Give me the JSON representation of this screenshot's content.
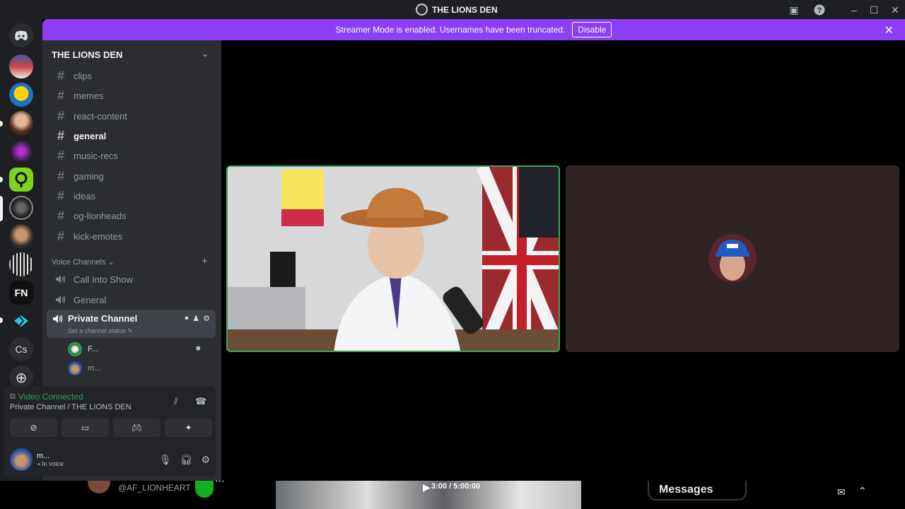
{
  "window": {
    "title": "THE LIONS DEN"
  },
  "banner": {
    "text": "Streamer Mode is enabled. Usernames have been truncated.",
    "button": "Disable"
  },
  "server": {
    "name": "THE LIONS DEN"
  },
  "rail": {
    "last_label": "Cs"
  },
  "channels": [
    {
      "label": "clips"
    },
    {
      "label": "memes"
    },
    {
      "label": "react-content"
    },
    {
      "label": "general"
    },
    {
      "label": "music-recs"
    },
    {
      "label": "gaming"
    },
    {
      "label": "ideas"
    },
    {
      "label": "og-lionheads"
    },
    {
      "label": "kick-emotes"
    }
  ],
  "voice": {
    "category": "Voice Channels",
    "channels": [
      {
        "label": "Call Into Show"
      },
      {
        "label": "General"
      }
    ],
    "private": {
      "label": "Private Channel",
      "status": "Set a channel status"
    },
    "users": [
      {
        "label": "F..."
      },
      {
        "label": "m..."
      }
    ]
  },
  "connection": {
    "status": "Video Connected",
    "location": "Private Channel / THE LIONS DEN"
  },
  "me": {
    "name": "m...",
    "status": "In voice"
  },
  "overlay": {
    "handle": "@AF_LIONHEART",
    "timecode": "3:00 / 5:00:00",
    "messages": "Messages"
  },
  "colors": {
    "banner": "#8c3ff5",
    "accent_green": "#23a55a",
    "speaking_border": "#3ba55c"
  }
}
